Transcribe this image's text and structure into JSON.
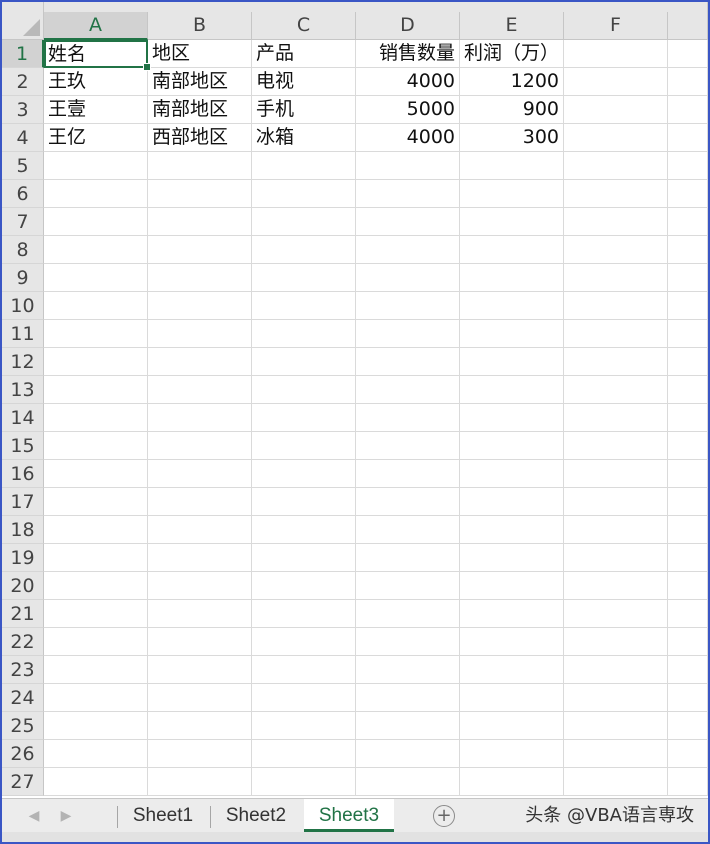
{
  "columns": [
    "A",
    "B",
    "C",
    "D",
    "E",
    "F"
  ],
  "rows": [
    "1",
    "2",
    "3",
    "4",
    "5",
    "6",
    "7",
    "8",
    "9",
    "10",
    "11",
    "12",
    "13",
    "14",
    "15",
    "16",
    "17",
    "18",
    "19",
    "20",
    "21",
    "22",
    "23",
    "24",
    "25",
    "26",
    "27"
  ],
  "active_cell": "A1",
  "cells": [
    [
      "姓名",
      "地区",
      "产品",
      "销售数量",
      "利润（万）",
      ""
    ],
    [
      "王玖",
      "南部地区",
      "电视",
      "4000",
      "1200",
      ""
    ],
    [
      "王壹",
      "南部地区",
      "手机",
      "5000",
      "900",
      ""
    ],
    [
      "王亿",
      "西部地区",
      "冰箱",
      "4000",
      "300",
      ""
    ]
  ],
  "sheet_tabs": [
    {
      "label": "Sheet1",
      "active": false
    },
    {
      "label": "Sheet2",
      "active": false
    },
    {
      "label": "Sheet3",
      "active": true
    }
  ],
  "nav": {
    "prev": "◀",
    "next": "▶"
  },
  "add_sheet_symbol": "+",
  "watermark": "头条 @VBA语言専攻",
  "colors": {
    "accent": "#217346",
    "frame": "#3a56c5"
  }
}
